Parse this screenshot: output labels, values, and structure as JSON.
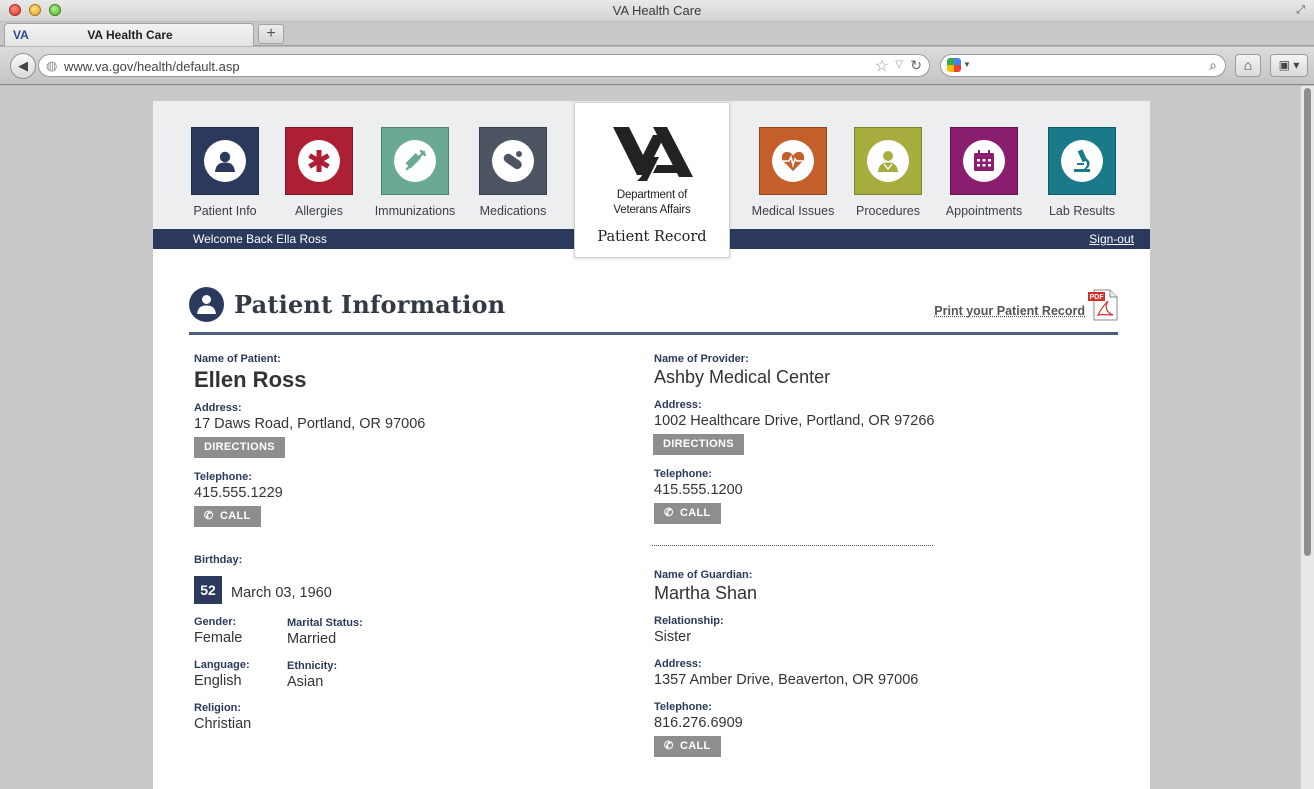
{
  "browser": {
    "window_title": "VA Health Care",
    "tab_title": "VA Health Care",
    "new_tab_label": "+",
    "url": "www.va.gov/health/default.asp",
    "search_value": ""
  },
  "nav": {
    "items": [
      {
        "label": "Patient Info",
        "icon": "patient-icon",
        "color": "#2b3a5c"
      },
      {
        "label": "Allergies",
        "icon": "medical-star-icon",
        "color": "#ad1f33"
      },
      {
        "label": "Immunizations",
        "icon": "syringe-icon",
        "color": "#6aaa94"
      },
      {
        "label": "Medications",
        "icon": "pill-icon",
        "color": "#4d5563"
      },
      {
        "label": "Medical Issues",
        "icon": "heart-monitor-icon",
        "color": "#c45f2b"
      },
      {
        "label": "Procedures",
        "icon": "doctor-icon",
        "color": "#a6ad3c"
      },
      {
        "label": "Appointments",
        "icon": "calendar-icon",
        "color": "#8a1d6e"
      },
      {
        "label": "Lab Results",
        "icon": "microscope-icon",
        "color": "#1b7a8a"
      }
    ],
    "logo": {
      "dept_line1": "Department of",
      "dept_line2": "Veterans Affairs",
      "title": "Patient Record"
    },
    "welcome": "Welcome Back Ella Ross",
    "signout": "Sign-out"
  },
  "section": {
    "title": "Patient Information",
    "print_link": "Print your Patient Record",
    "pdf_label": "PDF"
  },
  "patient": {
    "name_label": "Name of Patient:",
    "name": "Ellen Ross",
    "address_label": "Address:",
    "address": "17 Daws Road, Portland, OR 97006",
    "directions_label": "DIRECTIONS",
    "telephone_label": "Telephone:",
    "telephone": "415.555.1229",
    "call_label": "CALL",
    "birthday_label": "Birthday:",
    "age": "52",
    "birthday": "March 03, 1960",
    "gender_label": "Gender:",
    "gender": "Female",
    "marital_label": "Marital Status:",
    "marital": "Married",
    "language_label": "Language:",
    "language": "English",
    "ethnicity_label": "Ethnicity:",
    "ethnicity": "Asian",
    "religion_label": "Religion:",
    "religion": "Christian"
  },
  "provider": {
    "name_label": "Name of Provider:",
    "name": "Ashby Medical Center",
    "address_label": "Address:",
    "address": "1002 Healthcare Drive, Portland, OR 97266",
    "directions_label": "DIRECTIONS",
    "telephone_label": "Telephone:",
    "telephone": "415.555.1200",
    "call_label": "CALL"
  },
  "guardian": {
    "name_label": "Name of Guardian:",
    "name": "Martha Shan",
    "relationship_label": "Relationship:",
    "relationship": "Sister",
    "address_label": "Address:",
    "address": "1357 Amber Drive, Beaverton, OR 97006",
    "telephone_label": "Telephone:",
    "telephone": "816.276.6909",
    "call_label": "CALL"
  }
}
